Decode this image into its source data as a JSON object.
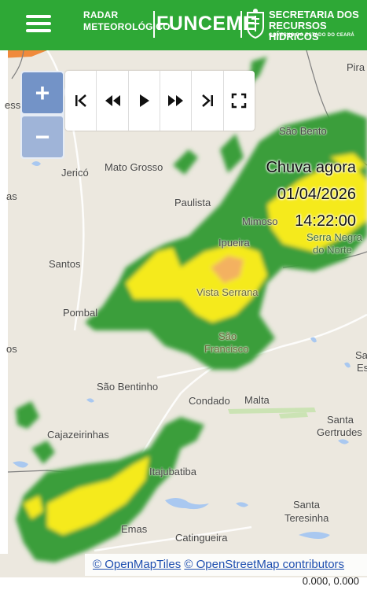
{
  "header": {
    "radar_line1": "RADAR",
    "radar_line2": "METEOROLÓGICO",
    "funceme": "FUNCEME",
    "secretaria_line1": "SECRETARIA DOS",
    "secretaria_line2": "RECURSOS HÍDRICOS",
    "gov": "GOVERNO DO ESTADO DO CEARÁ",
    "brand_color": "#2ea836"
  },
  "overlay": {
    "title": "Chuva agora",
    "date": "01/04/2026",
    "time": "14:22:00"
  },
  "controls": {
    "zoom_in": "+",
    "zoom_out": "−",
    "playback_icons": [
      "skip-to-start-icon",
      "rewind-icon",
      "play-icon",
      "fast-forward-icon",
      "skip-to-end-icon",
      "fullscreen-icon"
    ]
  },
  "places": {
    "santos": "Santos",
    "jerico": "Jericó",
    "mato_grosso": "Mato Grosso",
    "paulista": "Paulista",
    "mimoso": "Mimoso",
    "ipueira": "Ipueira",
    "sao_bento": "São Bento",
    "serra_negra": "Serra Negra",
    "do_norte": "do Norte",
    "pombal": "Pombal",
    "vista_serrana": "Vista Serrana",
    "sao_francisco_1": "São",
    "sao_francisco_2": "Francisco",
    "sao_bentinho": "São Bentinho",
    "condado": "Condado",
    "malta": "Malta",
    "santa_gertrudes_1": "Santa",
    "santa_gertrudes_2": "Gertrudes",
    "cajazeirinhas": "Cajazeirinhas",
    "itajubatiba": "Itajubatiba",
    "santa_teresinha_1": "Santa",
    "santa_teresinha_2": "Teresinha",
    "emas": "Emas",
    "catingueira": "Catingueira",
    "pira": "Pira",
    "left_esso": "esso",
    "left_os": "os",
    "left_as": "as",
    "right_sa": "Sa",
    "right_es": "Es"
  },
  "attribution": {
    "openmaptiles": "© OpenMapTiles",
    "openstreetmap": "© OpenStreetMap contributors"
  },
  "coords": "0.000, 0.000"
}
